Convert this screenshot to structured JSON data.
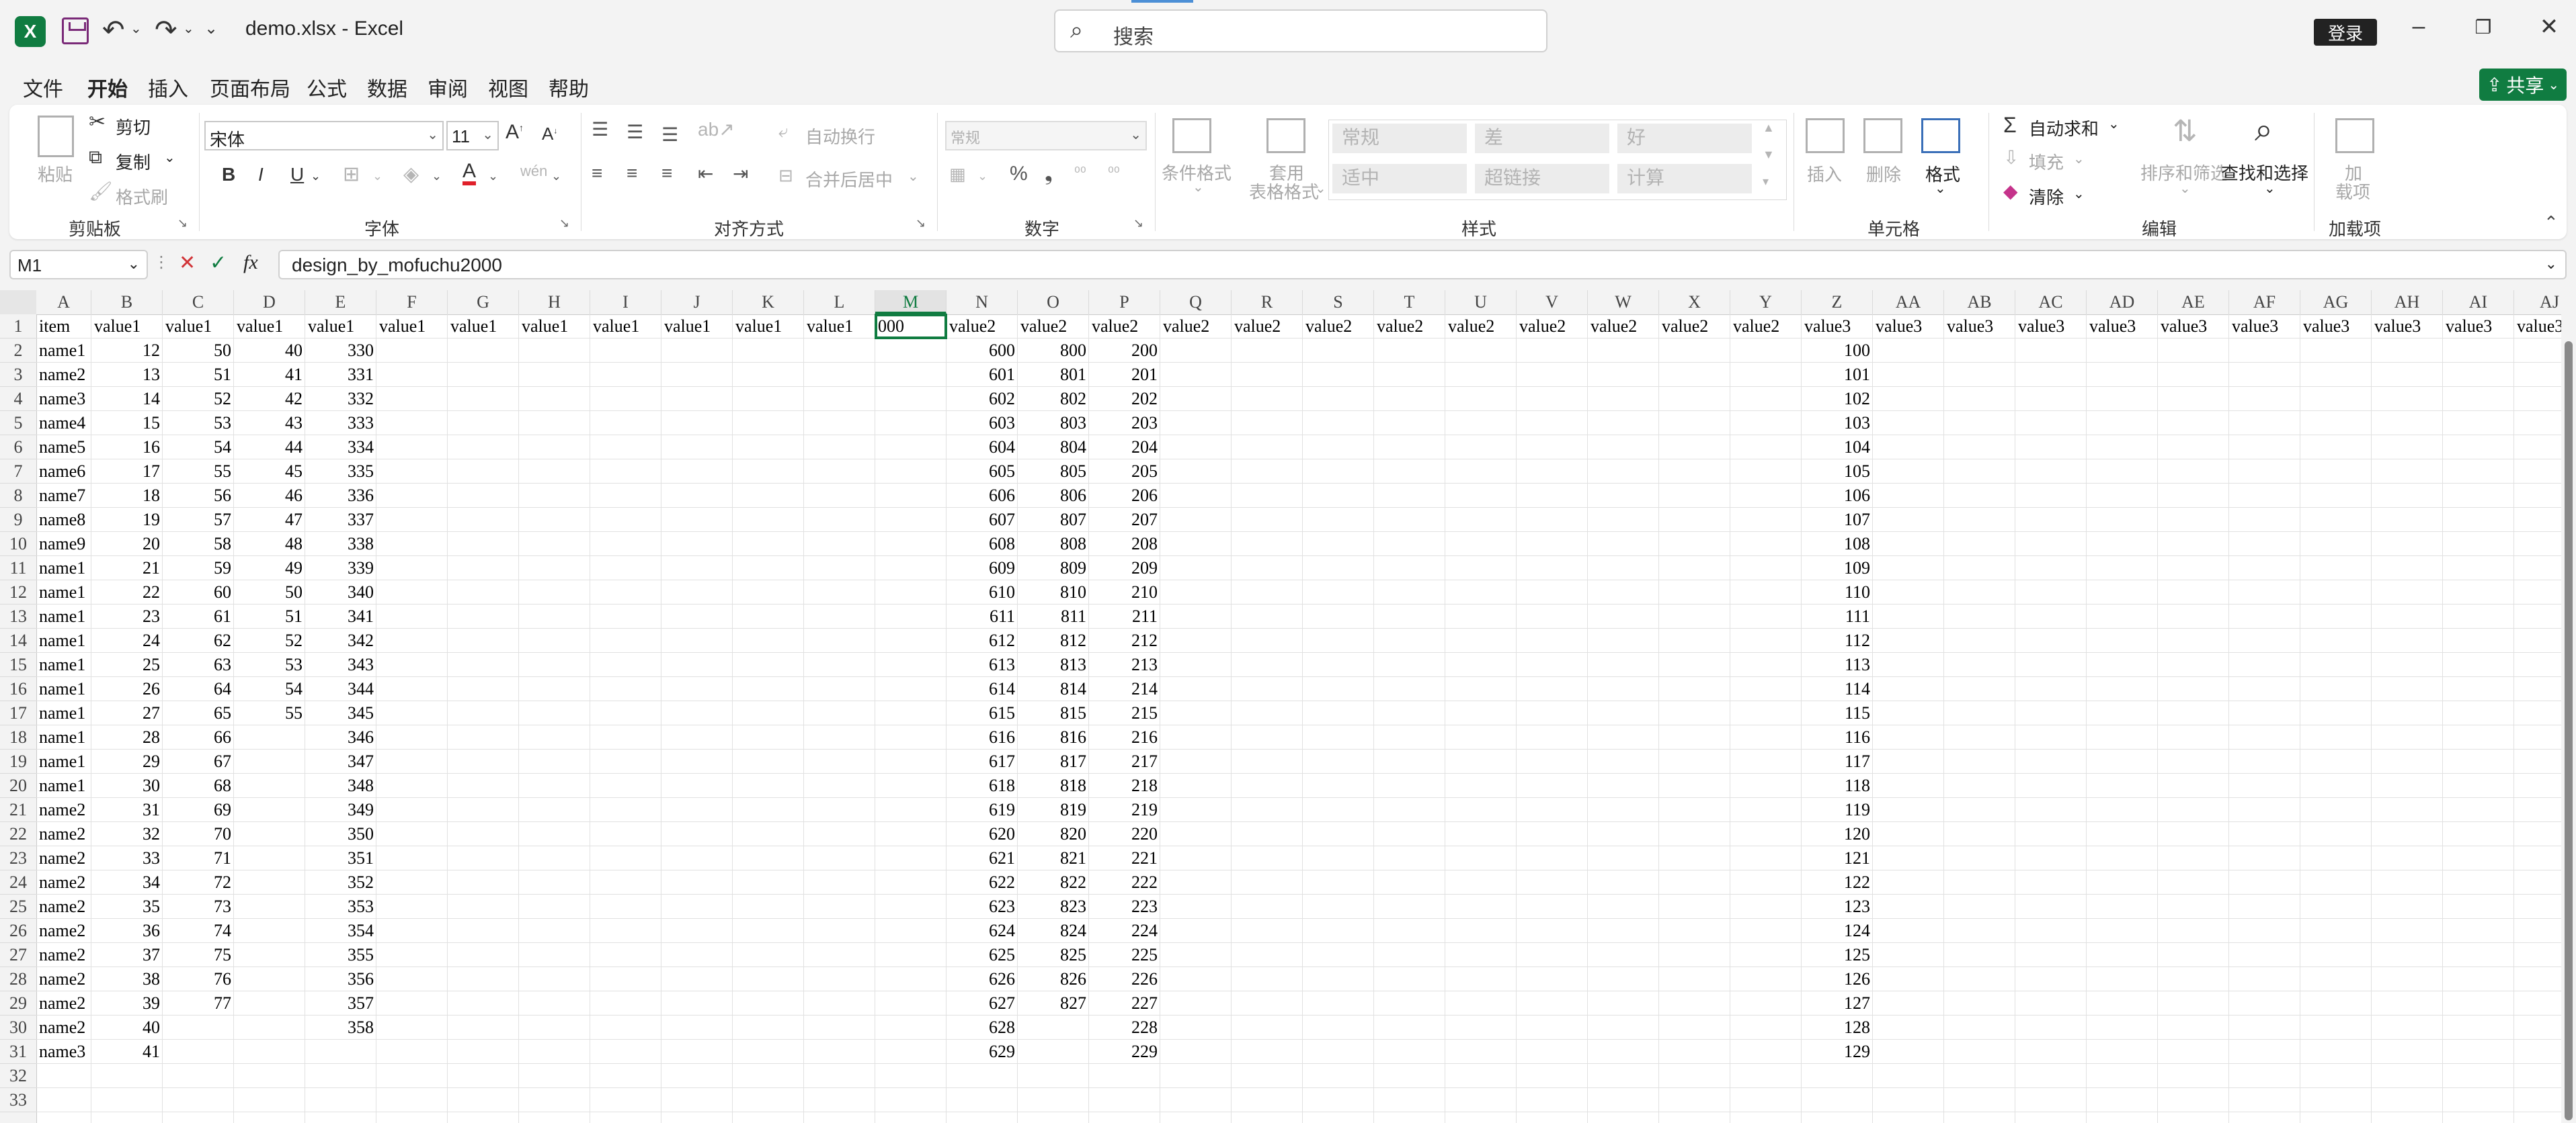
{
  "titlebar": {
    "doc_title": "demo.xlsx  -  Excel",
    "search_placeholder": "搜索",
    "login_label": "登录"
  },
  "menu": {
    "tabs": [
      "文件",
      "开始",
      "插入",
      "页面布局",
      "公式",
      "数据",
      "审阅",
      "视图",
      "帮助"
    ],
    "active": "开始",
    "share_label": "共享"
  },
  "ribbon": {
    "clipboard": {
      "label": "剪贴板",
      "paste": "粘贴",
      "cut": "剪切",
      "copy": "复制",
      "format_painter": "格式刷"
    },
    "font": {
      "label": "字体",
      "name": "宋体",
      "size": "11"
    },
    "alignment": {
      "label": "对齐方式",
      "wrap_text": "自动换行",
      "merge_center": "合并后居中"
    },
    "number": {
      "label": "数字",
      "format": "常规"
    },
    "styles": {
      "label": "样式",
      "conditional_format": "条件格式",
      "table_format_1": "套用",
      "table_format_2": "表格格式",
      "cells": [
        "常规",
        "差",
        "好",
        "适中",
        "超链接",
        "计算"
      ]
    },
    "cells_group": {
      "label": "单元格",
      "insert": "插入",
      "delete": "删除",
      "format": "格式"
    },
    "editing": {
      "label": "编辑",
      "autosum": "自动求和",
      "fill": "填充",
      "clear": "清除",
      "sort_filter": "排序和筛选",
      "find_select": "查找和选择"
    },
    "addins": {
      "label": "加载项",
      "label_1": "加",
      "label_2": "载项"
    }
  },
  "formula_bar": {
    "name_box": "M1",
    "content": "design_by_mofuchu2000"
  },
  "sheet": {
    "columns": [
      "A",
      "B",
      "C",
      "D",
      "E",
      "F",
      "G",
      "H",
      "I",
      "J",
      "K",
      "L",
      "M",
      "N",
      "O",
      "P",
      "Q",
      "R",
      "S",
      "T",
      "U",
      "V",
      "W",
      "X",
      "Y",
      "Z",
      "AA",
      "AB",
      "AC",
      "AD",
      "AE",
      "AF",
      "AG",
      "AH",
      "AI",
      "AJ"
    ],
    "selected_col": "M",
    "rows": [
      "1",
      "2",
      "3",
      "4",
      "5",
      "6",
      "7",
      "8",
      "9",
      "10",
      "11",
      "12",
      "13",
      "14",
      "15",
      "16",
      "17",
      "18",
      "19",
      "20",
      "21",
      "22",
      "23",
      "24",
      "25",
      "26",
      "27",
      "28",
      "29",
      "30",
      "31",
      "32",
      "33"
    ],
    "header_row": [
      "item",
      "value1",
      "value1",
      "value1",
      "value1",
      "value1",
      "value1",
      "value1",
      "value1",
      "value1",
      "value1",
      "value1",
      "000",
      "value2",
      "value2",
      "value2",
      "value2",
      "value2",
      "value2",
      "value2",
      "value2",
      "value2",
      "value2",
      "value2",
      "value2",
      "value3",
      "value3",
      "value3",
      "value3",
      "value3",
      "value3",
      "value3",
      "value3",
      "value3",
      "value3",
      "value3"
    ],
    "col_a": [
      "name1",
      "name2",
      "name3",
      "name4",
      "name5",
      "name6",
      "name7",
      "name8",
      "name9",
      "name1",
      "name1",
      "name1",
      "name1",
      "name1",
      "name1",
      "name1",
      "name1",
      "name1",
      "name1",
      "name2",
      "name2",
      "name2",
      "name2",
      "name2",
      "name2",
      "name2",
      "name2",
      "name2",
      "name2",
      "name3"
    ],
    "col_b": [
      "12",
      "13",
      "14",
      "15",
      "16",
      "17",
      "18",
      "19",
      "20",
      "21",
      "22",
      "23",
      "24",
      "25",
      "26",
      "27",
      "28",
      "29",
      "30",
      "31",
      "32",
      "33",
      "34",
      "35",
      "36",
      "37",
      "38",
      "39",
      "40",
      "41"
    ],
    "col_c": [
      "50",
      "51",
      "52",
      "53",
      "54",
      "55",
      "56",
      "57",
      "58",
      "59",
      "60",
      "61",
      "62",
      "63",
      "64",
      "65",
      "66",
      "67",
      "68",
      "69",
      "70",
      "71",
      "72",
      "73",
      "74",
      "75",
      "76",
      "77"
    ],
    "col_d": [
      "40",
      "41",
      "42",
      "43",
      "44",
      "45",
      "46",
      "47",
      "48",
      "49",
      "50",
      "51",
      "52",
      "53",
      "54",
      "55"
    ],
    "col_e": [
      "330",
      "331",
      "332",
      "333",
      "334",
      "335",
      "336",
      "337",
      "338",
      "339",
      "340",
      "341",
      "342",
      "343",
      "344",
      "345",
      "346",
      "347",
      "348",
      "349",
      "350",
      "351",
      "352",
      "353",
      "354",
      "355",
      "356",
      "357",
      "358"
    ],
    "col_n": [
      "600",
      "601",
      "602",
      "603",
      "604",
      "605",
      "606",
      "607",
      "608",
      "609",
      "610",
      "611",
      "612",
      "613",
      "614",
      "615",
      "616",
      "617",
      "618",
      "619",
      "620",
      "621",
      "622",
      "623",
      "624",
      "625",
      "626",
      "627",
      "628",
      "629"
    ],
    "col_o": [
      "800",
      "801",
      "802",
      "803",
      "804",
      "805",
      "806",
      "807",
      "808",
      "809",
      "810",
      "811",
      "812",
      "813",
      "814",
      "815",
      "816",
      "817",
      "818",
      "819",
      "820",
      "821",
      "822",
      "823",
      "824",
      "825",
      "826",
      "827"
    ],
    "col_p": [
      "200",
      "201",
      "202",
      "203",
      "204",
      "205",
      "206",
      "207",
      "208",
      "209",
      "210",
      "211",
      "212",
      "213",
      "214",
      "215",
      "216",
      "217",
      "218",
      "219",
      "220",
      "221",
      "222",
      "223",
      "224",
      "225",
      "226",
      "227",
      "228",
      "229"
    ],
    "col_z": [
      "100",
      "101",
      "102",
      "103",
      "104",
      "105",
      "106",
      "107",
      "108",
      "109",
      "110",
      "111",
      "112",
      "113",
      "114",
      "115",
      "116",
      "117",
      "118",
      "119",
      "120",
      "121",
      "122",
      "123",
      "124",
      "125",
      "126",
      "127",
      "128",
      "129"
    ]
  }
}
